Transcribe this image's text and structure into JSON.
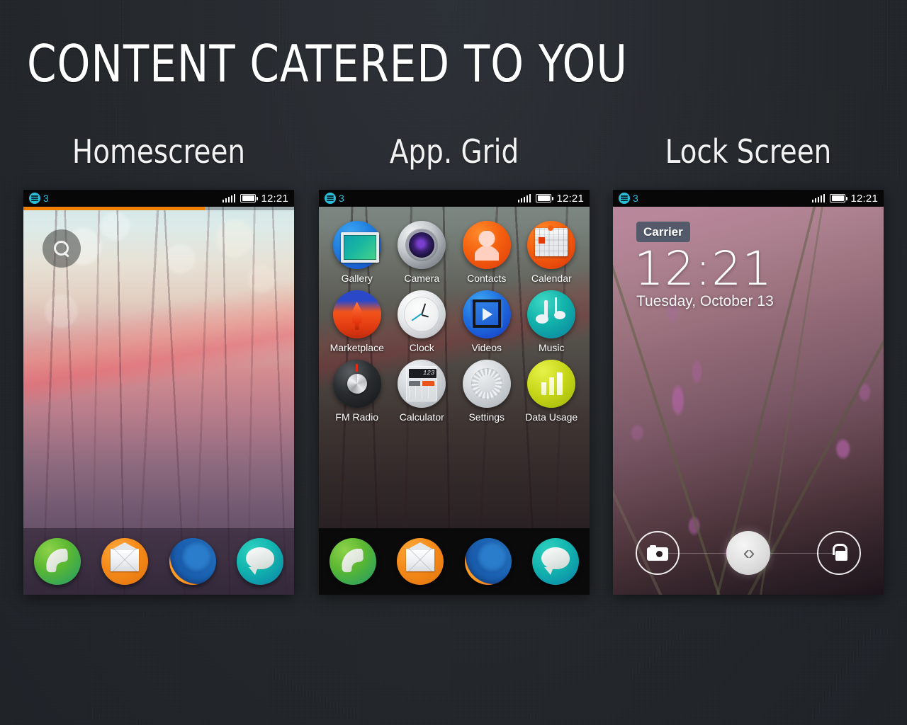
{
  "slide": {
    "title": "CONTENT CATERED TO YOU",
    "background_color": "#22262b",
    "captions": [
      "Homescreen",
      "App. Grid",
      "Lock Screen"
    ]
  },
  "status_bar": {
    "notification_count": "3",
    "notification_icon": "notifications-badge-icon",
    "signal_icon": "signal-bars-icon",
    "battery_icon": "battery-full-icon",
    "clock": "12:21"
  },
  "homescreen": {
    "search_icon": "search-icon",
    "progress_percent": 67,
    "progress_color": "#f08000"
  },
  "app_grid": {
    "apps": [
      {
        "label": "Gallery",
        "icon": "gallery-icon"
      },
      {
        "label": "Camera",
        "icon": "camera-icon"
      },
      {
        "label": "Contacts",
        "icon": "contacts-icon"
      },
      {
        "label": "Calendar",
        "icon": "calendar-icon"
      },
      {
        "label": "Marketplace",
        "icon": "marketplace-icon"
      },
      {
        "label": "Clock",
        "icon": "clock-icon"
      },
      {
        "label": "Videos",
        "icon": "videos-icon"
      },
      {
        "label": "Music",
        "icon": "music-icon"
      },
      {
        "label": "FM Radio",
        "icon": "fm-radio-icon"
      },
      {
        "label": "Calculator",
        "icon": "calculator-icon"
      },
      {
        "label": "Settings",
        "icon": "settings-icon"
      },
      {
        "label": "Data Usage",
        "icon": "data-usage-icon"
      }
    ],
    "calculator_display": "123"
  },
  "dock": {
    "items": [
      {
        "icon": "phone-icon",
        "name": "Phone"
      },
      {
        "icon": "email-icon",
        "name": "Email"
      },
      {
        "icon": "browser-icon",
        "name": "Browser"
      },
      {
        "icon": "messages-icon",
        "name": "Messages"
      }
    ]
  },
  "lock_screen": {
    "carrier": "Carrier",
    "time": "12:21",
    "date": "Tuesday, October 13",
    "actions": [
      {
        "icon": "camera-icon",
        "name": "Camera"
      },
      {
        "icon": "unlock-arrows-icon",
        "glyph": "‹›",
        "name": "Unlock slider"
      },
      {
        "icon": "padlock-unlocked-icon",
        "name": "Unlock"
      }
    ]
  }
}
